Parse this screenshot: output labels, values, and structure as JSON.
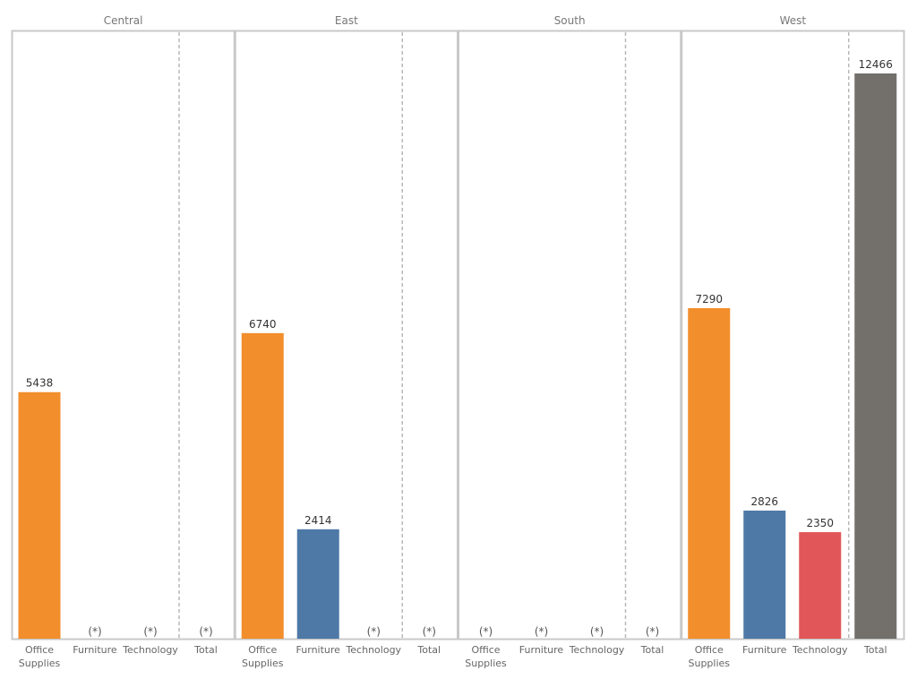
{
  "chart_data": {
    "type": "bar",
    "title": "",
    "xlabel": "",
    "ylabel": "",
    "ylim": [
      0,
      12466
    ],
    "grid": false,
    "legend": "none",
    "null_marker": "(*)",
    "colors": {
      "Office Supplies": "#f28e2b",
      "Furniture": "#4e79a7",
      "Technology": "#e15759",
      "Total": "#736f6a",
      "frame": "#c8c8c8",
      "divider": "#b8b8b8"
    },
    "panels": [
      {
        "region": "Central",
        "categories": [
          "Office Supplies",
          "Furniture",
          "Technology",
          "Total"
        ],
        "category_lines": [
          [
            "Office",
            "Supplies"
          ],
          [
            "Furniture"
          ],
          [
            "Technology"
          ],
          [
            "Total"
          ]
        ],
        "values": [
          5438,
          null,
          null,
          null
        ]
      },
      {
        "region": "East",
        "categories": [
          "Office Supplies",
          "Furniture",
          "Technology",
          "Total"
        ],
        "category_lines": [
          [
            "Office",
            "Supplies"
          ],
          [
            "Furniture"
          ],
          [
            "Technology"
          ],
          [
            "Total"
          ]
        ],
        "values": [
          6740,
          2414,
          null,
          null
        ]
      },
      {
        "region": "South",
        "categories": [
          "Office Supplies",
          "Furniture",
          "Technology",
          "Total"
        ],
        "category_lines": [
          [
            "Office",
            "Supplies"
          ],
          [
            "Furniture"
          ],
          [
            "Technology"
          ],
          [
            "Total"
          ]
        ],
        "values": [
          null,
          null,
          null,
          null
        ]
      },
      {
        "region": "West",
        "categories": [
          "Office Supplies",
          "Furniture",
          "Technology",
          "Total"
        ],
        "category_lines": [
          [
            "Office",
            "Supplies"
          ],
          [
            "Furniture"
          ],
          [
            "Technology"
          ],
          [
            "Total"
          ]
        ],
        "values": [
          7290,
          2826,
          2350,
          12466
        ]
      }
    ]
  }
}
